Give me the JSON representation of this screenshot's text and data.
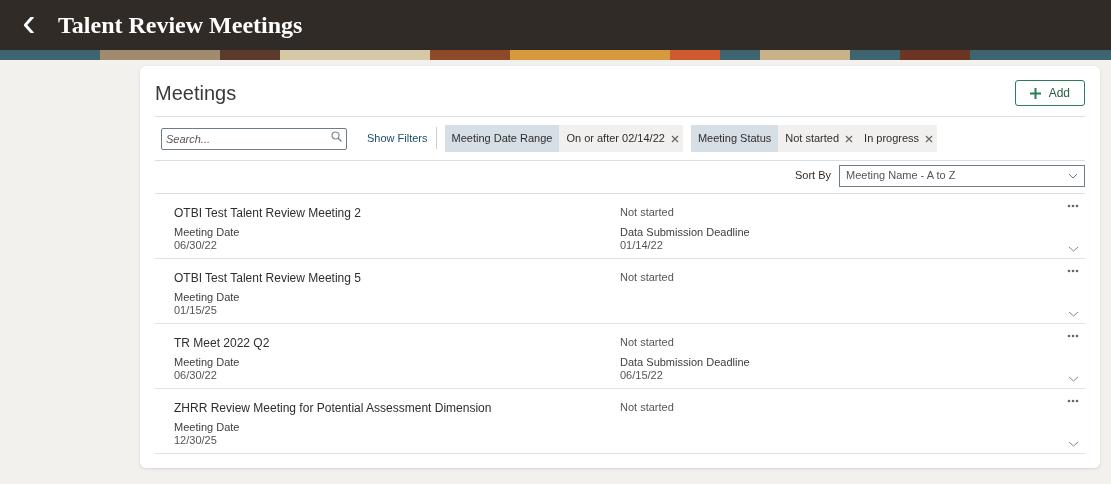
{
  "header": {
    "back": "‹",
    "title": "Talent Review Meetings"
  },
  "panel": {
    "title": "Meetings",
    "add_button": "Add"
  },
  "search": {
    "placeholder": "Search..."
  },
  "show_filters": "Show Filters",
  "filters": [
    {
      "label": "Meeting Date Range",
      "values": [
        "On or after 02/14/22"
      ]
    },
    {
      "label": "Meeting Status",
      "values": [
        "Not started",
        "In progress"
      ]
    }
  ],
  "sort": {
    "label": "Sort By",
    "value": "Meeting Name - A to Z"
  },
  "meetings": [
    {
      "name": "OTBI Test Talent Review Meeting 2",
      "status": "Not started",
      "date_label": "Meeting Date",
      "date": "06/30/22",
      "deadline_label": "Data Submission Deadline",
      "deadline": "01/14/22"
    },
    {
      "name": "OTBI Test Talent Review Meeting 5",
      "status": "Not started",
      "date_label": "Meeting Date",
      "date": "01/15/25"
    },
    {
      "name": "TR Meet 2022 Q2",
      "status": "Not started",
      "date_label": "Meeting Date",
      "date": "06/30/22",
      "deadline_label": "Data Submission Deadline",
      "deadline": "06/15/22"
    },
    {
      "name": "ZHRR Review Meeting for Potential Assessment Dimension",
      "status": "Not started",
      "date_label": "Meeting Date",
      "date": "12/30/25"
    }
  ]
}
